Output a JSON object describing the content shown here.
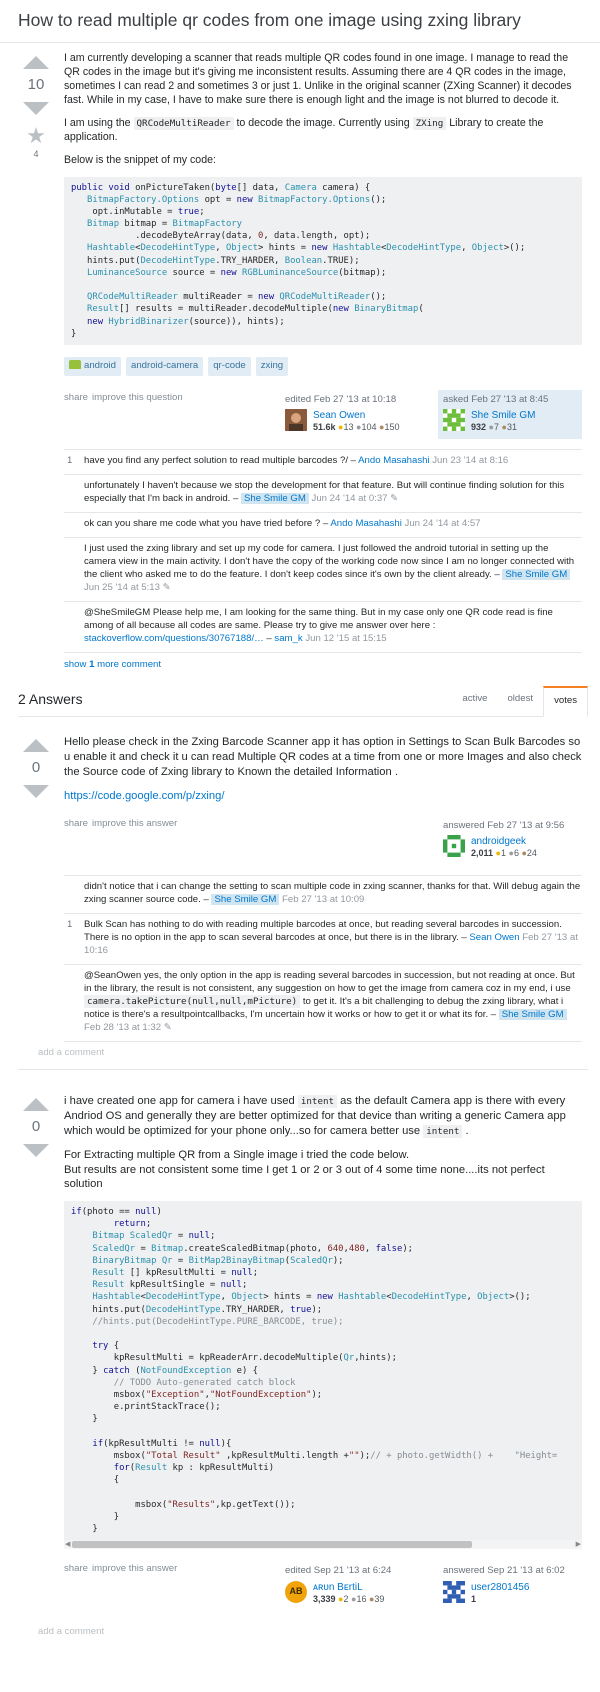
{
  "question": {
    "title": "How to read multiple qr codes from one image using zxing library",
    "votes": "10",
    "favorites": "4",
    "p1": "I am currently developing a scanner that reads multiple QR codes found in one image. I manage to read the QR codes in the image but it's giving me inconsistent results. Assuming there are 4 QR codes in the image, sometimes I can read 2 and sometimes 3 or just 1. Unlike in the original scanner (ZXing Scanner) it decodes fast. While in my case, I have to make sure there is enough light and the image is not blurred to decode it.",
    "p2a": "I am using the ",
    "p2code1": "QRCodeMultiReader",
    "p2b": " to decode the image. Currently using ",
    "p2code2": "ZXing",
    "p2c": " Library to create the application.",
    "p3": "Below is the snippet of my code:",
    "tags": [
      "android",
      "android-camera",
      "qr-code",
      "zxing"
    ],
    "menu": {
      "share": "share",
      "improve": "improve this question"
    },
    "edited": {
      "time": "edited Feb 27 '13 at 10:18",
      "name": "Sean Owen",
      "rep": "51.6k",
      "gold": "13",
      "silver": "104",
      "bronze": "150"
    },
    "asked": {
      "time": "asked Feb 27 '13 at 8:45",
      "name": "She Smile GM",
      "rep": "932",
      "silver": "7",
      "bronze": "31"
    },
    "comments": [
      {
        "score": "1",
        "text": "have you find any perfect solution to read multiple barcodes ?/ – ",
        "user": "Ando Masahashi",
        "date": " Jun 23 '14 at 8:16"
      },
      {
        "score": "",
        "text": "unfortunately I haven't because we stop the development for that feature. But will continue finding solution for this especially that I'm back in android. – ",
        "user": "She Smile GM",
        "date": " Jun 24 '14 at 0:37 ✎"
      },
      {
        "score": "",
        "text": "ok can you share me code what you have tried before ? – ",
        "user": "Ando Masahashi",
        "date": " Jun 24 '14 at 4:57"
      },
      {
        "score": "",
        "text": "I just used the zxing library and set up my code for camera. I just followed the android tutorial in setting up the camera view in the main activity. I don't have the copy of the working code now since I am no longer connected with the client who asked me to do the feature. I don't keep codes since it's own by the client already. – ",
        "user": "She Smile GM",
        "date": " Jun 25 '14 at 5:13 ✎"
      },
      {
        "score": "",
        "text": "@SheSmileGM Please help me, I am looking for the same thing. But in my case only one QR code read is fine among of all because all codes are same. Please try to give me answer over here : ",
        "link": "stackoverflow.com/questions/30767188/…",
        "text2": " – ",
        "user": "sam_k",
        "date": " Jun 12 '15 at 15:15"
      }
    ],
    "show_more_a": "show ",
    "show_more_b": "1",
    "show_more_c": " more comment"
  },
  "answers_header": {
    "title": "2 Answers",
    "tabs": [
      "active",
      "oldest",
      "votes"
    ]
  },
  "answer1": {
    "votes": "0",
    "p1": "Hello please check in the Zxing Barcode Scanner app it has option in Settings to Scan Bulk Barcodes so u enable it and check it u can read Multiple QR codes at a time from one or more Images and also check the Source code of Zxing library to Known the detailed Information .",
    "link": "https://code.google.com/p/zxing/",
    "menu": {
      "share": "share",
      "improve": "improve this answer"
    },
    "answered": {
      "time": "answered Feb 27 '13 at 9:56",
      "name": "androidgeek",
      "rep": "2,011",
      "gold": "1",
      "silver": "6",
      "bronze": "24"
    },
    "comments": [
      {
        "score": "",
        "text": "didn't notice that i can change the setting to scan multiple code in zxing scanner, thanks for that. Will debug again the zxing scanner source code. – ",
        "user": "She Smile GM",
        "date": " Feb 27 '13 at 10:09"
      },
      {
        "score": "1",
        "text": "Bulk Scan has nothing to do with reading multiple barcodes at once, but reading several barcodes in succession. There is no option in the app to scan several barcodes at once, but there is in the library. – ",
        "user": "Sean Owen",
        "date": " Feb 27 '13 at 10:16"
      },
      {
        "score": "",
        "text": "@SeanOwen yes, the only option in the app is reading several barcodes in succession, but not reading at once. But in the library, the result is not consistent, any suggestion on how to get the image from camera coz in my end, i use ",
        "code": "camera.takePicture(null,null,mPicture)",
        "text2": " to get it. It's a bit challenging to debug the zxing library, what i notice is there's a resultpointcallbacks, I'm uncertain how it works or how to get it or what its for. – ",
        "user": "She Smile GM",
        "date": " Feb 28 '13 at 1:32 ✎"
      }
    ],
    "add": "add a comment"
  },
  "answer2": {
    "votes": "0",
    "p1a": "i have created one app for camera i have used ",
    "p1code": "intent",
    "p1b": " as the default Camera app is there with every Andriod OS and generally they are better optimized for that device than writing a generic Camera app which would be optimized for your phone only...so for camera better use ",
    "p1code2": "intent",
    "p1c": " .",
    "p2": "For Extracting multiple QR from a Single image i tried the code below.",
    "p3": "But results are not consistent some time I get 1 or 2 or 3 out of 4 some time none....its not perfect solution",
    "menu": {
      "share": "share",
      "improve": "improve this answer"
    },
    "edited": {
      "time": "edited Sep 21 '13 at 6:24",
      "name": "ᴀʀᴜn BᴇrtiL",
      "initials": "AB",
      "rep": "3,339",
      "gold": "2",
      "silver": "16",
      "bronze": "39"
    },
    "answered": {
      "time": "answered Sep 21 '13 at 6:02",
      "name": "user2801456",
      "rep": "1"
    },
    "add": "add a comment"
  },
  "colors": {
    "accent": "#f48024",
    "link": "#0077cc",
    "tag_bg": "#e1ecf4",
    "owner_bg": "#e1ecf4"
  }
}
